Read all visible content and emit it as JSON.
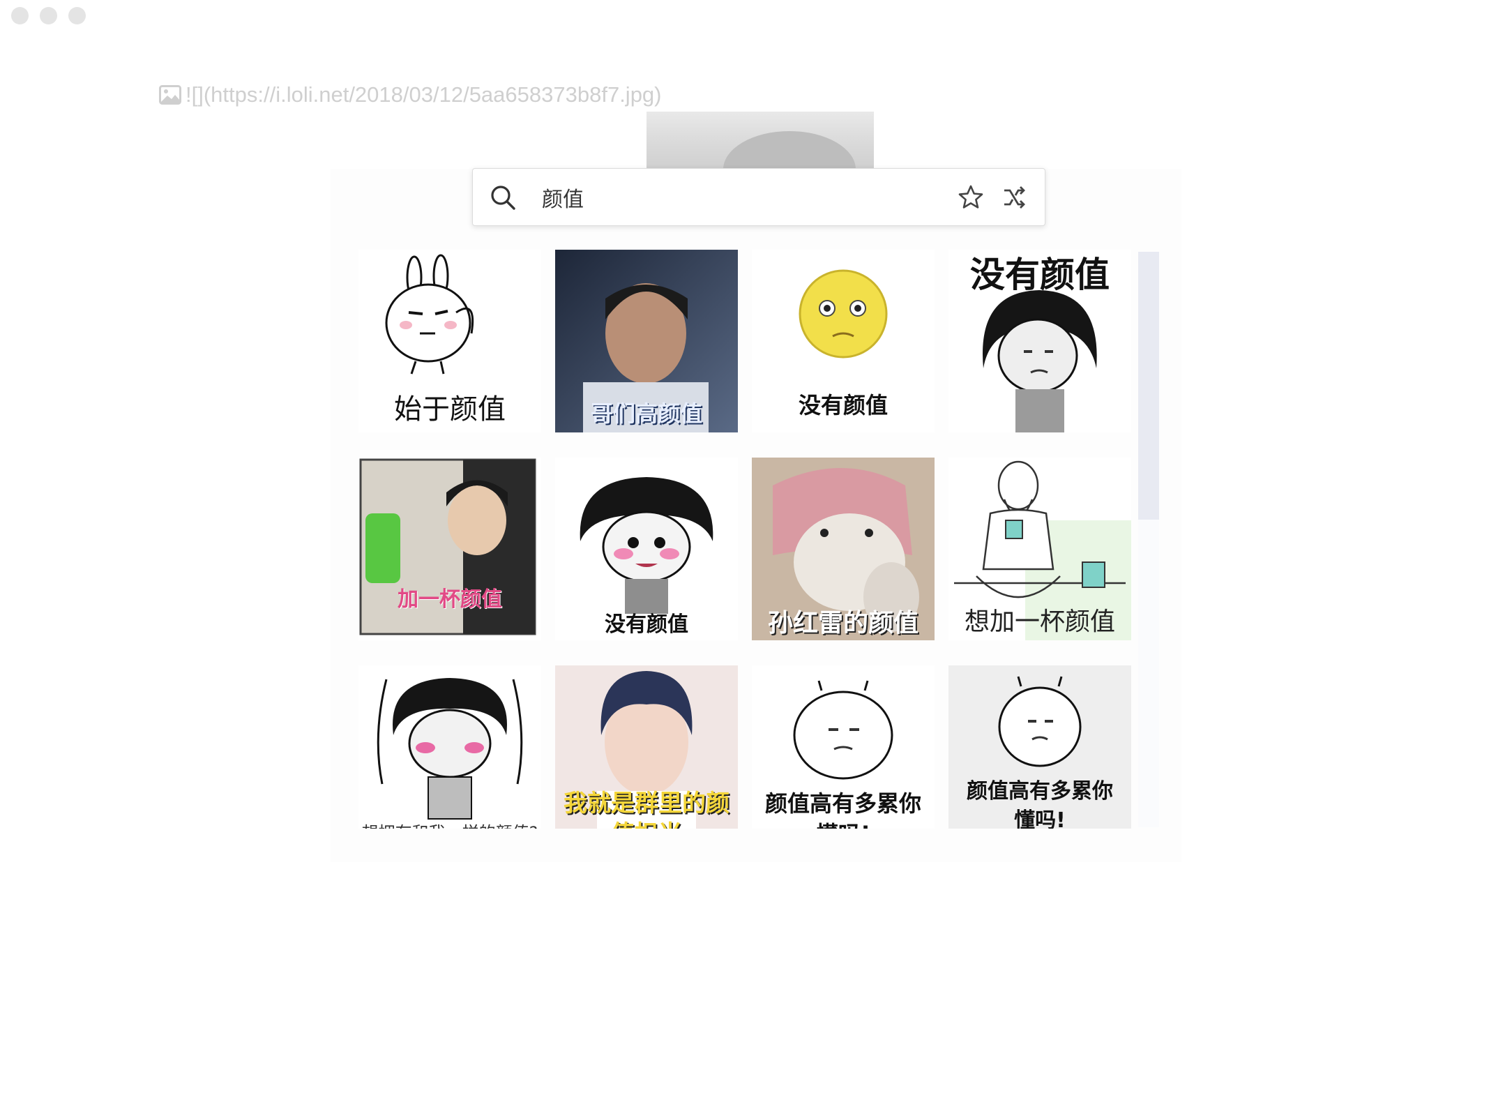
{
  "window": {
    "controls": [
      "close",
      "minimize",
      "zoom"
    ]
  },
  "editor": {
    "markdown_line": "![](https://i.loli.net/2018/03/12/5aa658373b8f7.jpg)"
  },
  "search": {
    "query": "颜值",
    "icons": {
      "search": "search-icon",
      "favorite": "star-icon",
      "random": "shuffle-icon"
    }
  },
  "stickers": [
    {
      "caption": "始于颜值"
    },
    {
      "caption": "哥们高颜值"
    },
    {
      "caption": "没有颜值"
    },
    {
      "caption": "没有颜值"
    },
    {
      "caption": "加一杯颜值"
    },
    {
      "caption": "没有颜值"
    },
    {
      "caption": "孙红雷的颜值"
    },
    {
      "caption": "想加一杯颜值"
    },
    {
      "caption": "想拥有和我一样的颜值?"
    },
    {
      "caption": "我就是群里的颜值担当"
    },
    {
      "caption": "颜值高有多累你懂吗!"
    },
    {
      "caption": "颜值高有多累你懂吗!"
    }
  ],
  "scrollbar": {
    "position_fraction": 0.0,
    "visible_fraction": 0.47
  }
}
